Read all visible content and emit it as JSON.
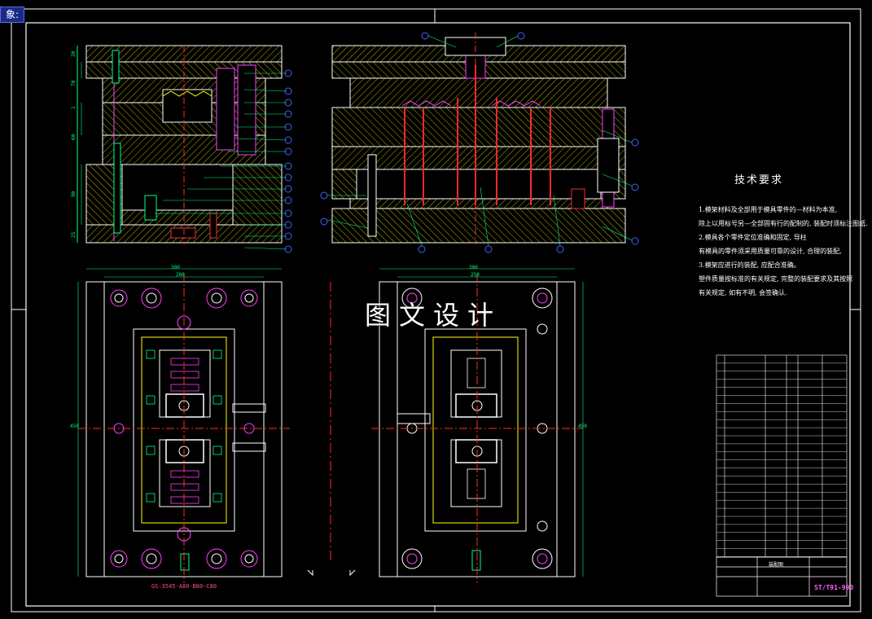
{
  "window": {
    "tab_label": "象:"
  },
  "technical_requirements": {
    "title": "技术要求",
    "lines": [
      "1.模架材料及全部用于模具零件的—材料为本准,",
      "除上以用标号另—全部固有行的配制的, 装配时须标注图纸.",
      "2.模具各个零件定位准确和固定, 导柱",
      "有模具的零件须采用质量可靠的设计, 合理的装配,",
      "3.模架应进行的装配, 应配合准确。",
      "塑件质量按标准的有关规定, 完整的装配要求及其按照",
      "有关规定, 如有不明, 会签确认."
    ]
  },
  "watermark": "图文设计",
  "part_number": "GS-3545-A80-B80-C80",
  "drawing_number": "ST/T91-900",
  "title_block": {
    "name_cell": "装配图"
  },
  "dimensions": {
    "top_outer": "300",
    "top_inner": "280",
    "right_outer": "300",
    "right_inner": "250",
    "side": "450"
  },
  "colors": {
    "bg": "#000000",
    "line": "#ffffff",
    "yellow": "#ffff00",
    "red": "#ff2a2a",
    "magenta": "#ff40ff",
    "blue": "#4060ff",
    "green": "#00ff7f",
    "cyan": "#40e0ff"
  }
}
